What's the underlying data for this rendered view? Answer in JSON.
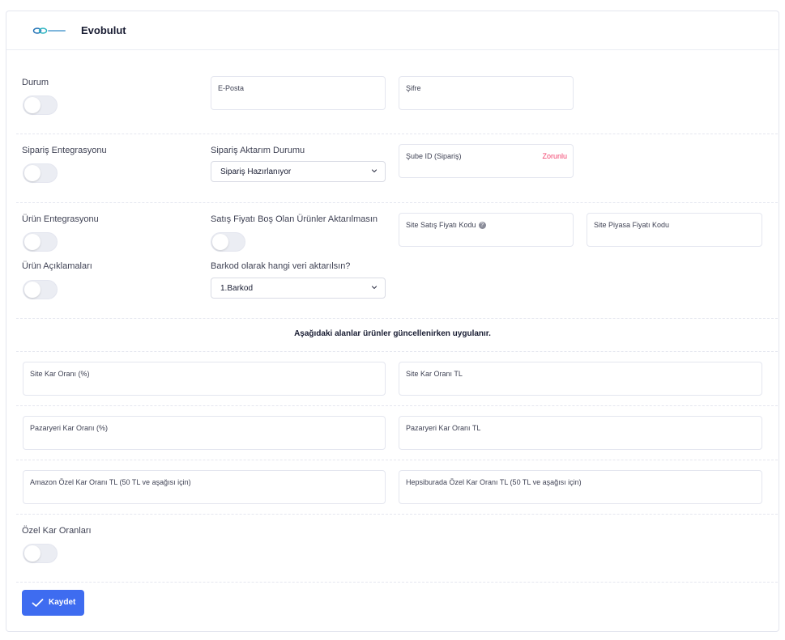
{
  "header": {
    "brand": "Evobulut",
    "logo_text": "evobulut"
  },
  "row1": {
    "durum_label": "Durum",
    "email_label": "E-Posta",
    "email_value": "",
    "password_label": "Şifre",
    "password_value": ""
  },
  "row2": {
    "siparis_label": "Sipariş Entegrasyonu",
    "aktarim_label": "Sipariş Aktarım Durumu",
    "aktarim_value": "Sipariş Hazırlanıyor",
    "sube_label": "Şube ID (Sipariş)",
    "sube_required": "Zorunlu",
    "sube_value": ""
  },
  "row3": {
    "urun_label": "Ürün Entegrasyonu",
    "satis_fiyati_label": "Satış Fiyatı Boş Olan Ürünler Aktarılmasın",
    "site_satis_label": "Site Satış Fiyatı Kodu",
    "site_satis_value": "",
    "site_piyasa_label": "Site Piyasa Fiyatı Kodu",
    "site_piyasa_value": "",
    "aciklama_label": "Ürün Açıklamaları",
    "barkod_label": "Barkod olarak hangi veri aktarılsın?",
    "barkod_value": "1.Barkod"
  },
  "notice": "Aşağıdaki alanlar ürünler güncellenirken uygulanır.",
  "kar": {
    "site_pct_label": "Site Kar Oranı (%)",
    "site_tl_label": "Site Kar Oranı TL",
    "pazar_pct_label": "Pazaryeri Kar Oranı (%)",
    "pazar_tl_label": "Pazaryeri Kar Oranı TL",
    "amazon_label": "Amazon Özel Kar Oranı TL (50 TL ve aşağısı için)",
    "hepsi_label": "Hepsiburada Özel Kar Oranı TL (50 TL ve aşağısı için)"
  },
  "ozel_kar_label": "Özel Kar Oranları",
  "save_label": "Kaydet",
  "colors": {
    "primary": "#3e6cf0",
    "required": "#f1416c",
    "toggle_off": "#ebedf3"
  },
  "toggles": {
    "durum": false,
    "siparis": false,
    "urun": false,
    "satis_fiyati": false,
    "aciklama": false,
    "ozel_kar": false
  }
}
